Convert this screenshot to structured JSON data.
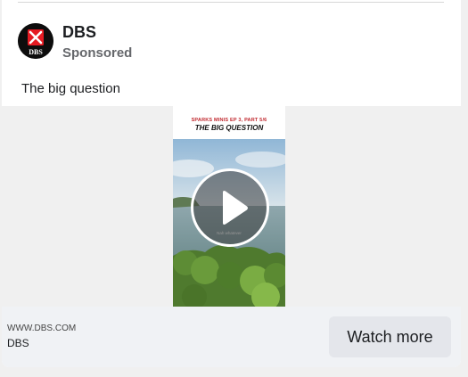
{
  "header": {
    "brand_name": "DBS",
    "sponsored_label": "Sponsored",
    "avatar_logo_text": "DBS"
  },
  "post": {
    "text": "The big question"
  },
  "video": {
    "caption_subtitle": "SPARKS MINIS EP 3, PART 5/6",
    "caption_title": "THE BIG QUESTION",
    "subtitle_text": "Nah whatever"
  },
  "footer": {
    "domain": "WWW.DBS.COM",
    "name": "DBS",
    "cta_label": "Watch more"
  },
  "colors": {
    "brand_red": "#e51b23",
    "caption_red": "#c0272d",
    "footer_bg": "#f0f2f5",
    "button_bg": "#e4e6eb"
  }
}
